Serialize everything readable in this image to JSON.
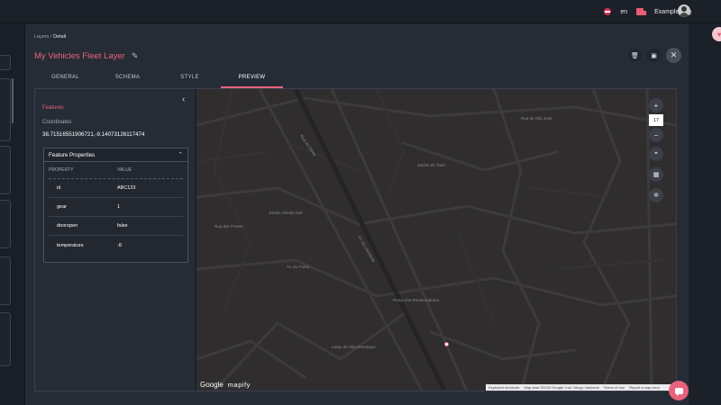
{
  "header": {
    "language": "en",
    "org_name": "Example Org"
  },
  "breadcrumb": {
    "parent": "Layers",
    "separator": "/",
    "current": "Detail"
  },
  "layer": {
    "title": "My Vehicles Fleet Layer"
  },
  "tabs": [
    {
      "label": "GENERAL",
      "active": false
    },
    {
      "label": "SCHEMA",
      "active": false
    },
    {
      "label": "STYLE",
      "active": false
    },
    {
      "label": "PREVIEW",
      "active": true
    }
  ],
  "feature_panel": {
    "title": "Features",
    "coordinates_label": "Coordinates",
    "coordinates_value": "38.71516551906721,-9.14073126117474",
    "properties_title": "Feature Properties",
    "column_property": "PROPERTY",
    "column_value": "VALUE",
    "rows": [
      {
        "property": "id",
        "value": "ABC123"
      },
      {
        "property": "gear",
        "value": "1"
      },
      {
        "property": "dooropen",
        "value": "false"
      },
      {
        "property": "temperature",
        "value": "-8"
      }
    ]
  },
  "map": {
    "zoom_level": "17",
    "zoom_in": "+",
    "zoom_out": "−",
    "brand_google": "Google",
    "brand_mapify": "mapify",
    "attribution": [
      "Keyboard shortcuts",
      "Map data ©2022 Google, Inst. Geogr. Nacional",
      "Terms of Use",
      "Report a map error"
    ],
    "labels": [
      "Jardim do Torel",
      "Jardim Alfredo Keil",
      "Praça dos Restauradores",
      "Largo de São Domingos",
      "Rua das Pretas",
      "Av. da Liberdade",
      "Rua de São José",
      "Tv. do Forno",
      "Rua da Glória"
    ]
  },
  "colors": {
    "accent": "#e8627d",
    "background": "#262c36",
    "map": "#2f2d2e"
  }
}
